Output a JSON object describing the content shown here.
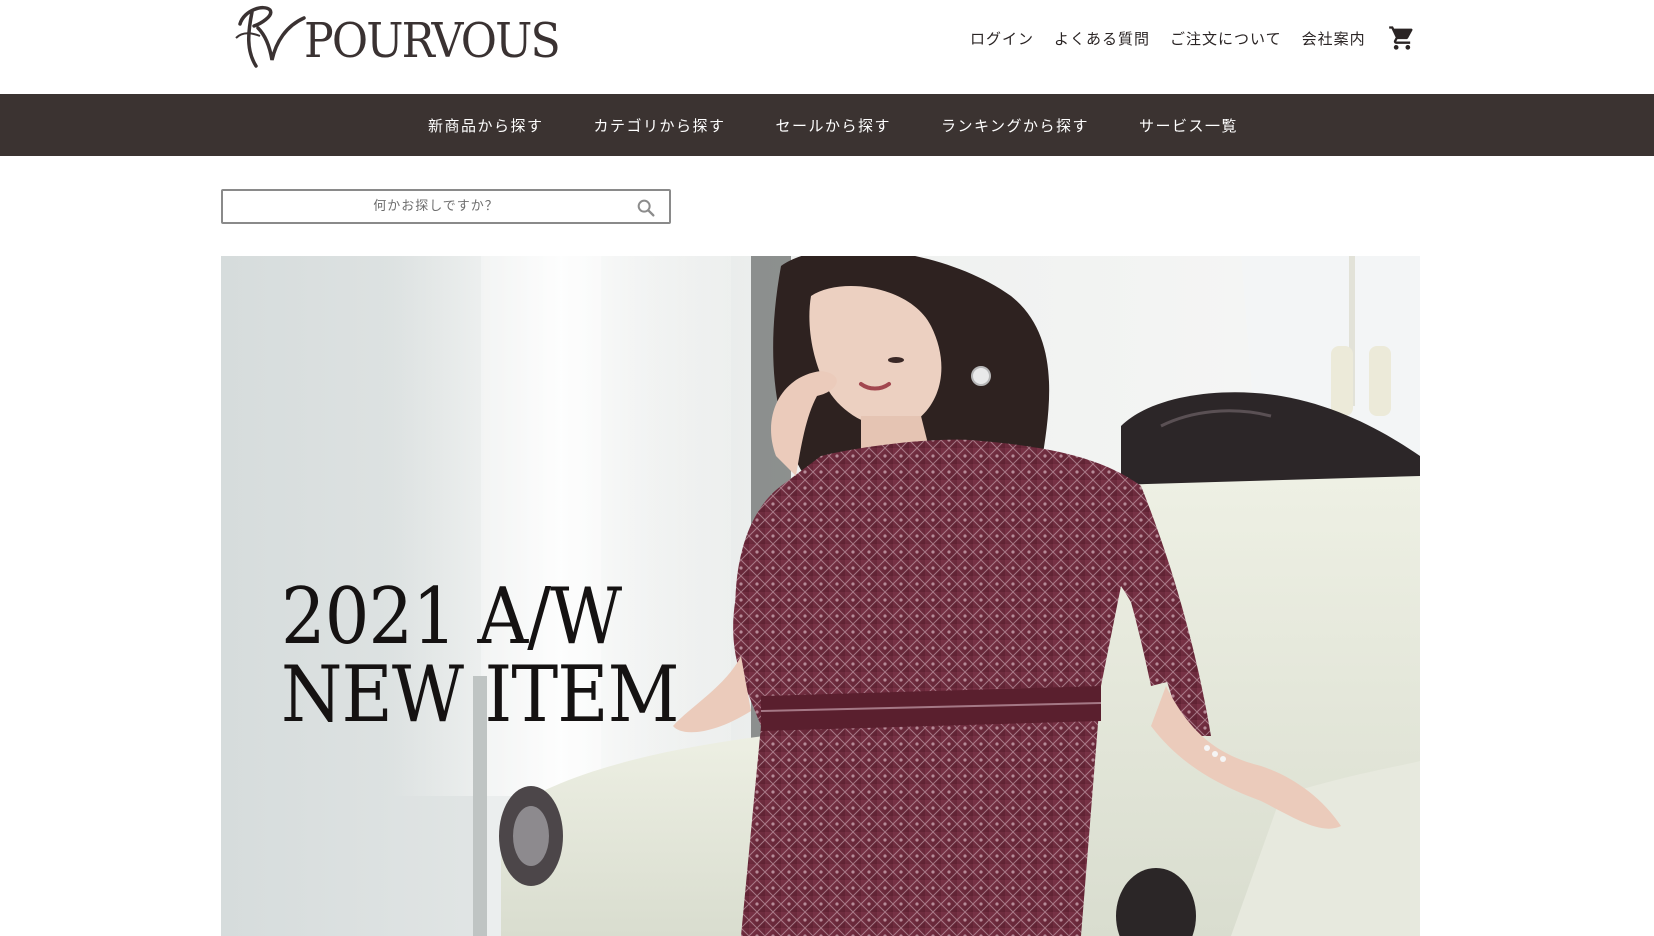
{
  "header": {
    "logo_text": "POURVOUS",
    "util_links": [
      "ログイン",
      "よくある質問",
      "ご注文について",
      "会社案内"
    ],
    "cart_icon": "cart-icon"
  },
  "catbar": {
    "items": [
      "新商品から探す",
      "カテゴリから探す",
      "セールから探す",
      "ランキングから探す",
      "サービス一覧"
    ]
  },
  "search": {
    "placeholder": "何かお探しですか？",
    "icon": "search-icon"
  },
  "hero": {
    "title_line1": "2021 A/W",
    "title_line2": "NEW ITEM"
  },
  "colors": {
    "catbar_bg": "#3b3331",
    "text": "#2a2424",
    "dress": "#6e2a3c"
  }
}
